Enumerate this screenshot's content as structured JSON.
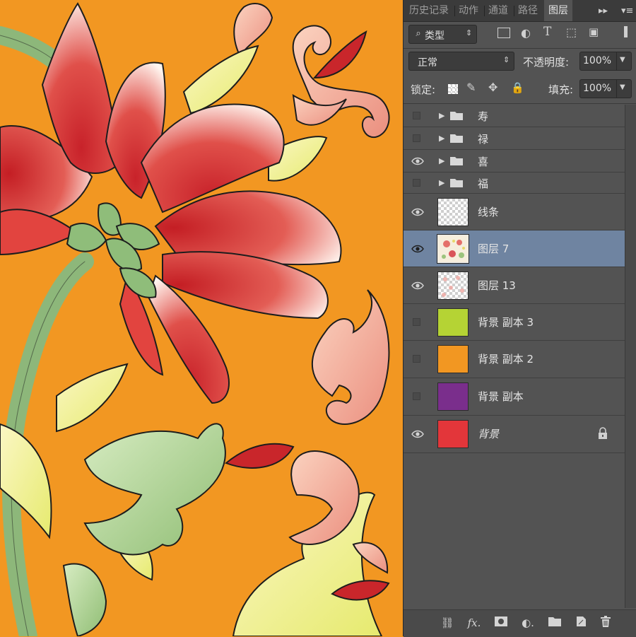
{
  "tabs": [
    "历史记录",
    "动作",
    "通道",
    "路径",
    "图层"
  ],
  "active_tab": "图层",
  "filter": {
    "kind_label": "类型"
  },
  "blend": {
    "mode": "正常",
    "opacity_label": "不透明度:",
    "opacity_value": "100%"
  },
  "lock": {
    "label": "锁定:",
    "fill_label": "填充:",
    "fill_value": "100%"
  },
  "layers": [
    {
      "name": "寿",
      "type": "group",
      "visible": false
    },
    {
      "name": "禄",
      "type": "group",
      "visible": false
    },
    {
      "name": "喜",
      "type": "group",
      "visible": true
    },
    {
      "name": "福",
      "type": "group",
      "visible": false
    },
    {
      "name": "线条",
      "type": "layer",
      "visible": true,
      "thumb": "transparent"
    },
    {
      "name": "图层 7",
      "type": "layer",
      "visible": true,
      "thumb": "artwork",
      "selected": true
    },
    {
      "name": "图层 13",
      "type": "layer",
      "visible": true,
      "thumb": "transparent-pattern"
    },
    {
      "name": "背景 副本 3",
      "type": "layer",
      "visible": false,
      "thumb_color": "#b5d334"
    },
    {
      "name": "背景 副本 2",
      "type": "layer",
      "visible": false,
      "thumb_color": "#f29722"
    },
    {
      "name": "背景 副本",
      "type": "layer",
      "visible": false,
      "thumb_color": "#7a2e8c"
    },
    {
      "name": "背景",
      "type": "background",
      "visible": true,
      "thumb_color": "#e3363a",
      "locked": true
    }
  ],
  "bottom_icons": [
    "link-icon",
    "fx-icon",
    "mask-icon",
    "adjustment-icon",
    "folder-icon",
    "new-layer-icon",
    "trash-icon"
  ],
  "colors": {
    "canvas_bg": "#f29722",
    "panel_bg": "#535353",
    "selected_row": "#6f84a1"
  }
}
